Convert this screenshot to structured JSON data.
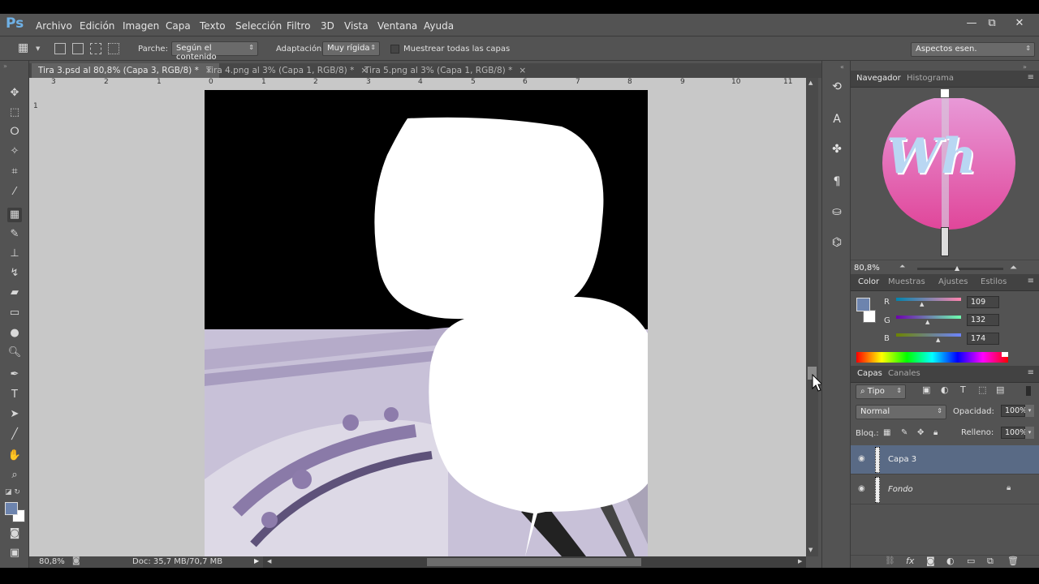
{
  "app": {
    "logo": "Ps"
  },
  "menu": [
    "Archivo",
    "Edición",
    "Imagen",
    "Capa",
    "Texto",
    "Selección",
    "Filtro",
    "3D",
    "Vista",
    "Ventana",
    "Ayuda"
  ],
  "window_controls": {
    "minimize": "—",
    "restore": "⧉",
    "close": "✕"
  },
  "options": {
    "parche_label": "Parche:",
    "parche_value": "Según el contenido",
    "adaptacion_label": "Adaptación:",
    "adaptacion_value": "Muy rígida",
    "sample_all_label": "Muestrear todas las capas",
    "workspace": "Aspectos esen."
  },
  "tabs": [
    {
      "label": "Tira 3.psd al 80,8% (Capa 3, RGB/8) *",
      "active": true
    },
    {
      "label": "Tira 4.png al 3% (Capa 1, RGB/8) *",
      "active": false
    },
    {
      "label": "Tira 5.png al 3% (Capa 1, RGB/8) *",
      "active": false
    }
  ],
  "ruler_h_ticks": [
    "3",
    "2",
    "1",
    "0",
    "1",
    "2",
    "3",
    "4",
    "5",
    "6",
    "7",
    "8",
    "9",
    "10",
    "11"
  ],
  "ruler_v_ticks": [
    "1"
  ],
  "status": {
    "zoom": "80,8%",
    "doc": "Doc: 35,7 MB/70,7 MB"
  },
  "navigator": {
    "tab1": "Navegador",
    "tab2": "Histograma",
    "zoom": "80,8%",
    "logo_text": "Wh"
  },
  "color_panel": {
    "tabs": [
      "Color",
      "Muestras",
      "Ajustes",
      "Estilos"
    ],
    "r_label": "R",
    "g_label": "G",
    "b_label": "B",
    "r": "109",
    "g": "132",
    "b": "174",
    "foreground": "#6d84ae"
  },
  "layers_panel": {
    "tabs": [
      "Capas",
      "Canales"
    ],
    "filter": "Tipo",
    "blend_mode": "Normal",
    "opacity_label": "Opacidad:",
    "opacity": "100%",
    "lock_label": "Bloq.:",
    "fill_label": "Relleno:",
    "fill": "100%",
    "layers": [
      {
        "name": "Capa 3",
        "selected": true,
        "locked": false
      },
      {
        "name": "Fondo",
        "selected": false,
        "locked": true
      }
    ]
  }
}
